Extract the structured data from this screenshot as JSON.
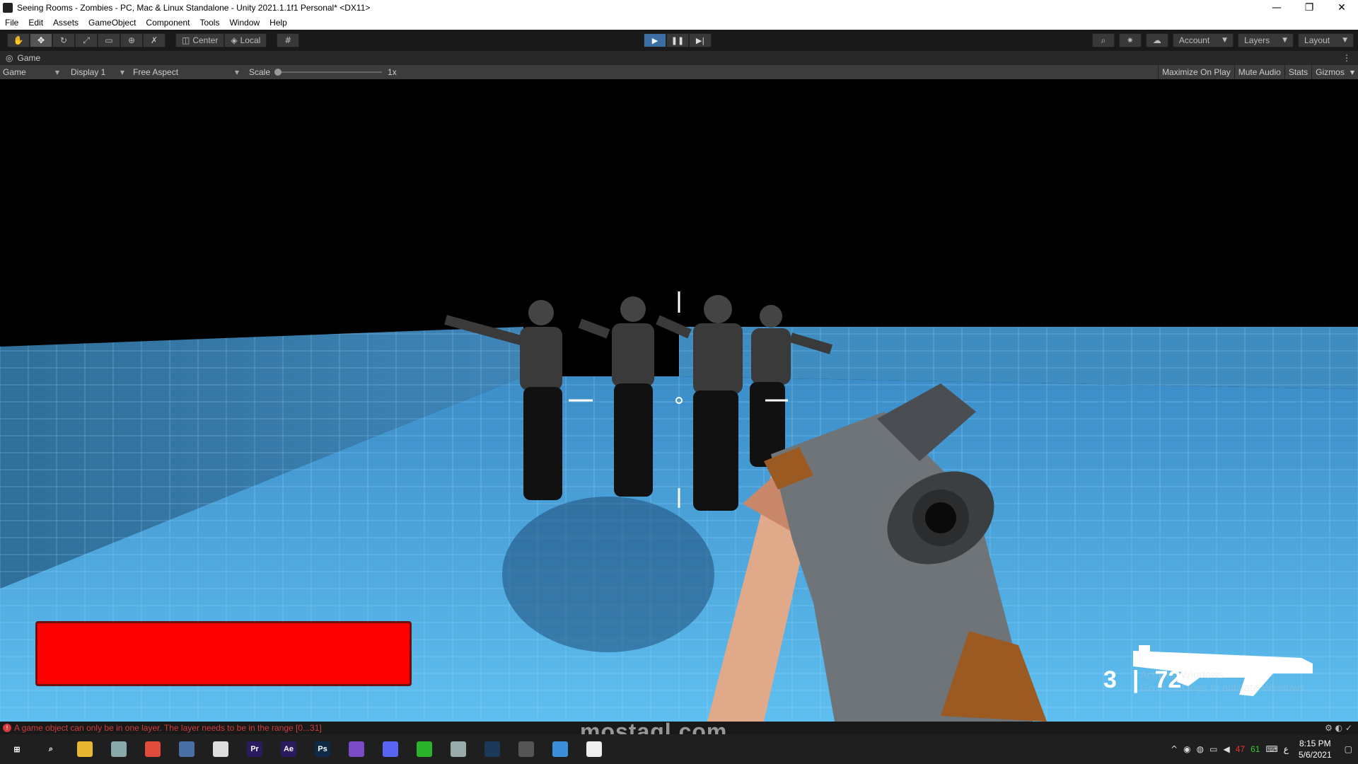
{
  "window": {
    "title": "Seeing Rooms - Zombies - PC, Mac & Linux Standalone - Unity 2021.1.1f1 Personal* <DX11>",
    "controls": [
      "—",
      "❐",
      "✕"
    ]
  },
  "menu": [
    "File",
    "Edit",
    "Assets",
    "GameObject",
    "Component",
    "Tools",
    "Window",
    "Help"
  ],
  "toolbar": {
    "tools": [
      "hand-icon",
      "move-icon",
      "rotate-icon",
      "scale-icon",
      "rect-icon",
      "transform-icon",
      "custom-tool-icon"
    ],
    "pivot_center": "Center",
    "pivot_local": "Local",
    "play": "▶",
    "pause": "❚❚",
    "step": "▶|",
    "account": "Account",
    "layers": "Layers",
    "layout": "Layout"
  },
  "game_tab": {
    "label": "Game",
    "view_select": "Game",
    "display": "Display 1",
    "aspect": "Free Aspect",
    "scale_label": "Scale",
    "scale_value": "1x",
    "maximize_on_play": "Maximize On Play",
    "mute_audio": "Mute Audio",
    "stats": "Stats",
    "gizmos": "Gizmos"
  },
  "hud": {
    "ammo_clip": "3",
    "ammo_separator": "|",
    "ammo_reserve": "72",
    "health_fraction": 1.0,
    "health_color": "#ff0000",
    "activate_line1": "Activate Windows",
    "activate_line2": "Go to Settings to activate Windows."
  },
  "status": {
    "message": "A game object can only be in one layer. The layer needs to be in the range [0...31]"
  },
  "taskbar": {
    "apps": [
      {
        "name": "start-icon",
        "label": "⊞",
        "color": "#1f1f1f"
      },
      {
        "name": "search-icon",
        "label": "⌕",
        "color": "#1f1f1f"
      },
      {
        "name": "file-explorer-icon",
        "label": "",
        "color": "#e8b830"
      },
      {
        "name": "app-icon",
        "label": "",
        "color": "#8aa"
      },
      {
        "name": "chrome-icon",
        "label": "",
        "color": "#e14b3b"
      },
      {
        "name": "calculator-icon",
        "label": "",
        "color": "#4a6fa5"
      },
      {
        "name": "unity-hub-icon",
        "label": "",
        "color": "#ddd"
      },
      {
        "name": "premiere-icon",
        "label": "Pr",
        "color": "#2a1a5e"
      },
      {
        "name": "after-effects-icon",
        "label": "Ae",
        "color": "#2a1a5e"
      },
      {
        "name": "photoshop-icon",
        "label": "Ps",
        "color": "#0d2a48"
      },
      {
        "name": "visual-studio-icon",
        "label": "",
        "color": "#7a4bc4"
      },
      {
        "name": "discord-icon",
        "label": "",
        "color": "#5865f2"
      },
      {
        "name": "green-app-icon",
        "label": "",
        "color": "#2bb32b"
      },
      {
        "name": "app-icon-2",
        "label": "",
        "color": "#9aa"
      },
      {
        "name": "steam-icon",
        "label": "",
        "color": "#1b3a5a"
      },
      {
        "name": "clapper-icon",
        "label": "",
        "color": "#555"
      },
      {
        "name": "photos-icon",
        "label": "",
        "color": "#3a8fd8"
      },
      {
        "name": "unity-icon",
        "label": "",
        "color": "#eee"
      }
    ],
    "tray_temp_cpu": "47",
    "tray_temp_gpu": "61",
    "lang": "ع",
    "time": "8:15 PM",
    "date": "5/6/2021"
  },
  "watermark": "mostaql.com"
}
